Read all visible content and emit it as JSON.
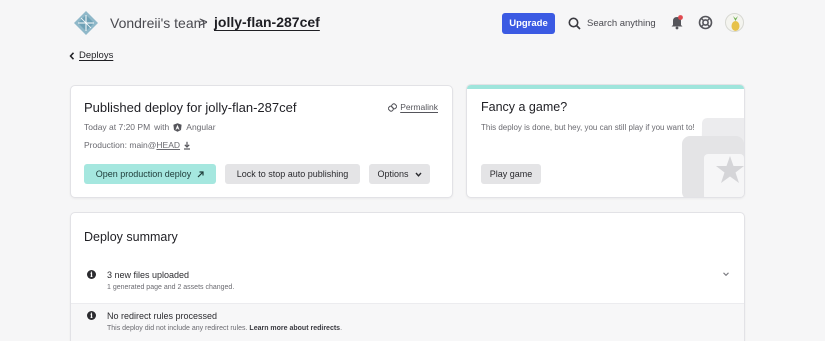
{
  "header": {
    "team": "Vondreii's team",
    "separator": ">",
    "site": "jolly-flan-287cef",
    "upgrade_label": "Upgrade",
    "search_label": "Search anything",
    "icons": [
      "netlify-logo-icon",
      "search-icon",
      "bell-icon",
      "help-icon",
      "avatar-icon"
    ],
    "accent_color": "#3b5ae3"
  },
  "breadcrumb": {
    "back_label": "Deploys"
  },
  "deploy_card": {
    "title": "Published deploy for jolly-flan-287cef",
    "permalink_label": "Permalink",
    "time": "Today at 7:20 PM",
    "with_label": "with",
    "framework": "Angular",
    "production_prefix": "Production: main@",
    "production_ref": "HEAD",
    "open_label": "Open production deploy",
    "lock_label": "Lock to stop auto publishing",
    "options_label": "Options"
  },
  "game_card": {
    "title": "Fancy a game?",
    "text": "This deploy is done, but hey, you can still play if you want to!",
    "play_label": "Play game",
    "accent_color": "#9fe5dc"
  },
  "summary": {
    "title": "Deploy summary",
    "rows": [
      {
        "title": "3 new files uploaded",
        "detail": "1 generated page and 2 assets changed."
      },
      {
        "title": "No redirect rules processed",
        "detail": "This deploy did not include any redirect rules.",
        "link": "Learn more about redirects",
        "link_suffix": "."
      }
    ]
  }
}
